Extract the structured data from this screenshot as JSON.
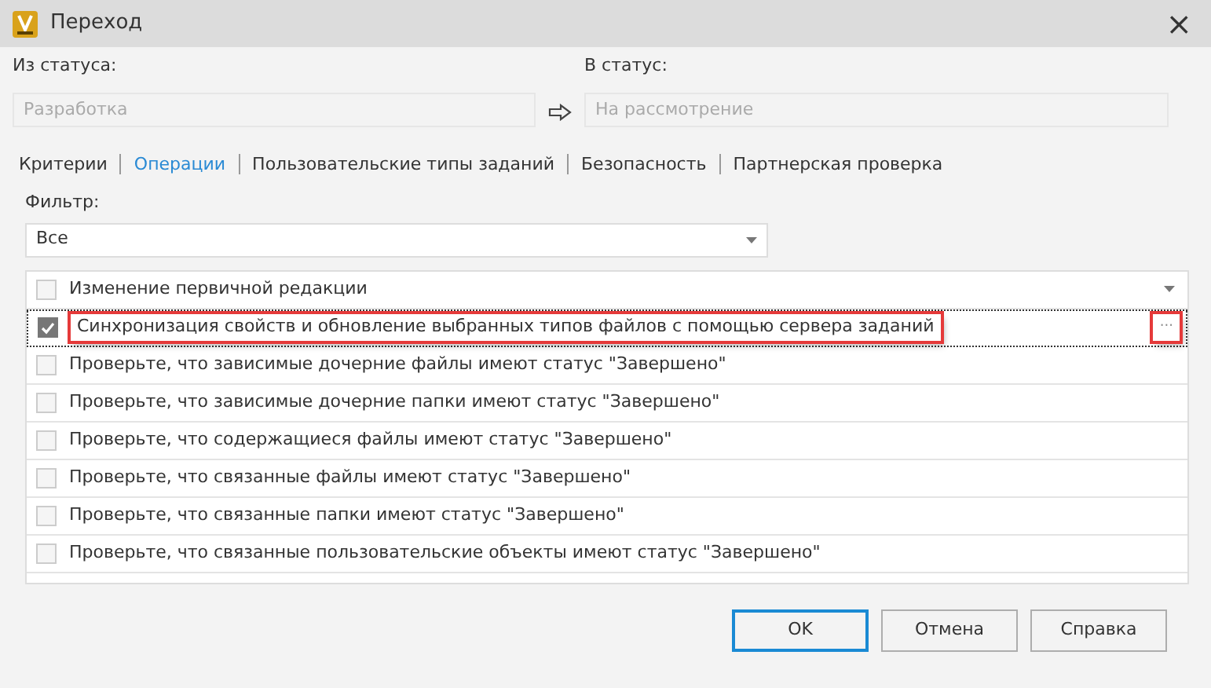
{
  "window": {
    "title": "Переход",
    "close": "×"
  },
  "from_status": {
    "label": "Из статуса:",
    "placeholder": "Разработка"
  },
  "to_status": {
    "label": "В статус:",
    "placeholder": "На рассмотрение"
  },
  "tabs": [
    {
      "label": "Критерии",
      "selected": false
    },
    {
      "label": "Операции",
      "selected": true
    },
    {
      "label": "Пользовательские типы заданий",
      "selected": false
    },
    {
      "label": "Безопасность",
      "selected": false
    },
    {
      "label": "Партнерская проверка",
      "selected": false
    }
  ],
  "filter": {
    "label": "Фильтр:",
    "value": "Все"
  },
  "operations": [
    {
      "label": "Изменение первичной редакции",
      "checked": false,
      "selected": false,
      "highlighted": false
    },
    {
      "label": "Синхронизация свойств и обновление выбранных типов файлов с помощью сервера заданий",
      "checked": true,
      "selected": true,
      "highlighted": true,
      "more": "···"
    },
    {
      "label": "Проверьте, что зависимые дочерние файлы имеют статус \"Завершено\"",
      "checked": false,
      "selected": false,
      "highlighted": false
    },
    {
      "label": "Проверьте, что зависимые дочерние папки имеют статус \"Завершено\"",
      "checked": false,
      "selected": false,
      "highlighted": false
    },
    {
      "label": "Проверьте, что содержащиеся файлы имеют статус \"Завершено\"",
      "checked": false,
      "selected": false,
      "highlighted": false
    },
    {
      "label": "Проверьте, что связанные файлы имеют статус \"Завершено\"",
      "checked": false,
      "selected": false,
      "highlighted": false
    },
    {
      "label": "Проверьте, что связанные папки имеют статус \"Завершено\"",
      "checked": false,
      "selected": false,
      "highlighted": false
    },
    {
      "label": "Проверьте, что связанные пользовательские объекты имеют статус \"Завершено\"",
      "checked": false,
      "selected": false,
      "highlighted": false
    }
  ],
  "buttons": [
    {
      "label": "OK",
      "default": true
    },
    {
      "label": "Отмена",
      "default": false
    },
    {
      "label": "Справка",
      "default": false
    }
  ]
}
